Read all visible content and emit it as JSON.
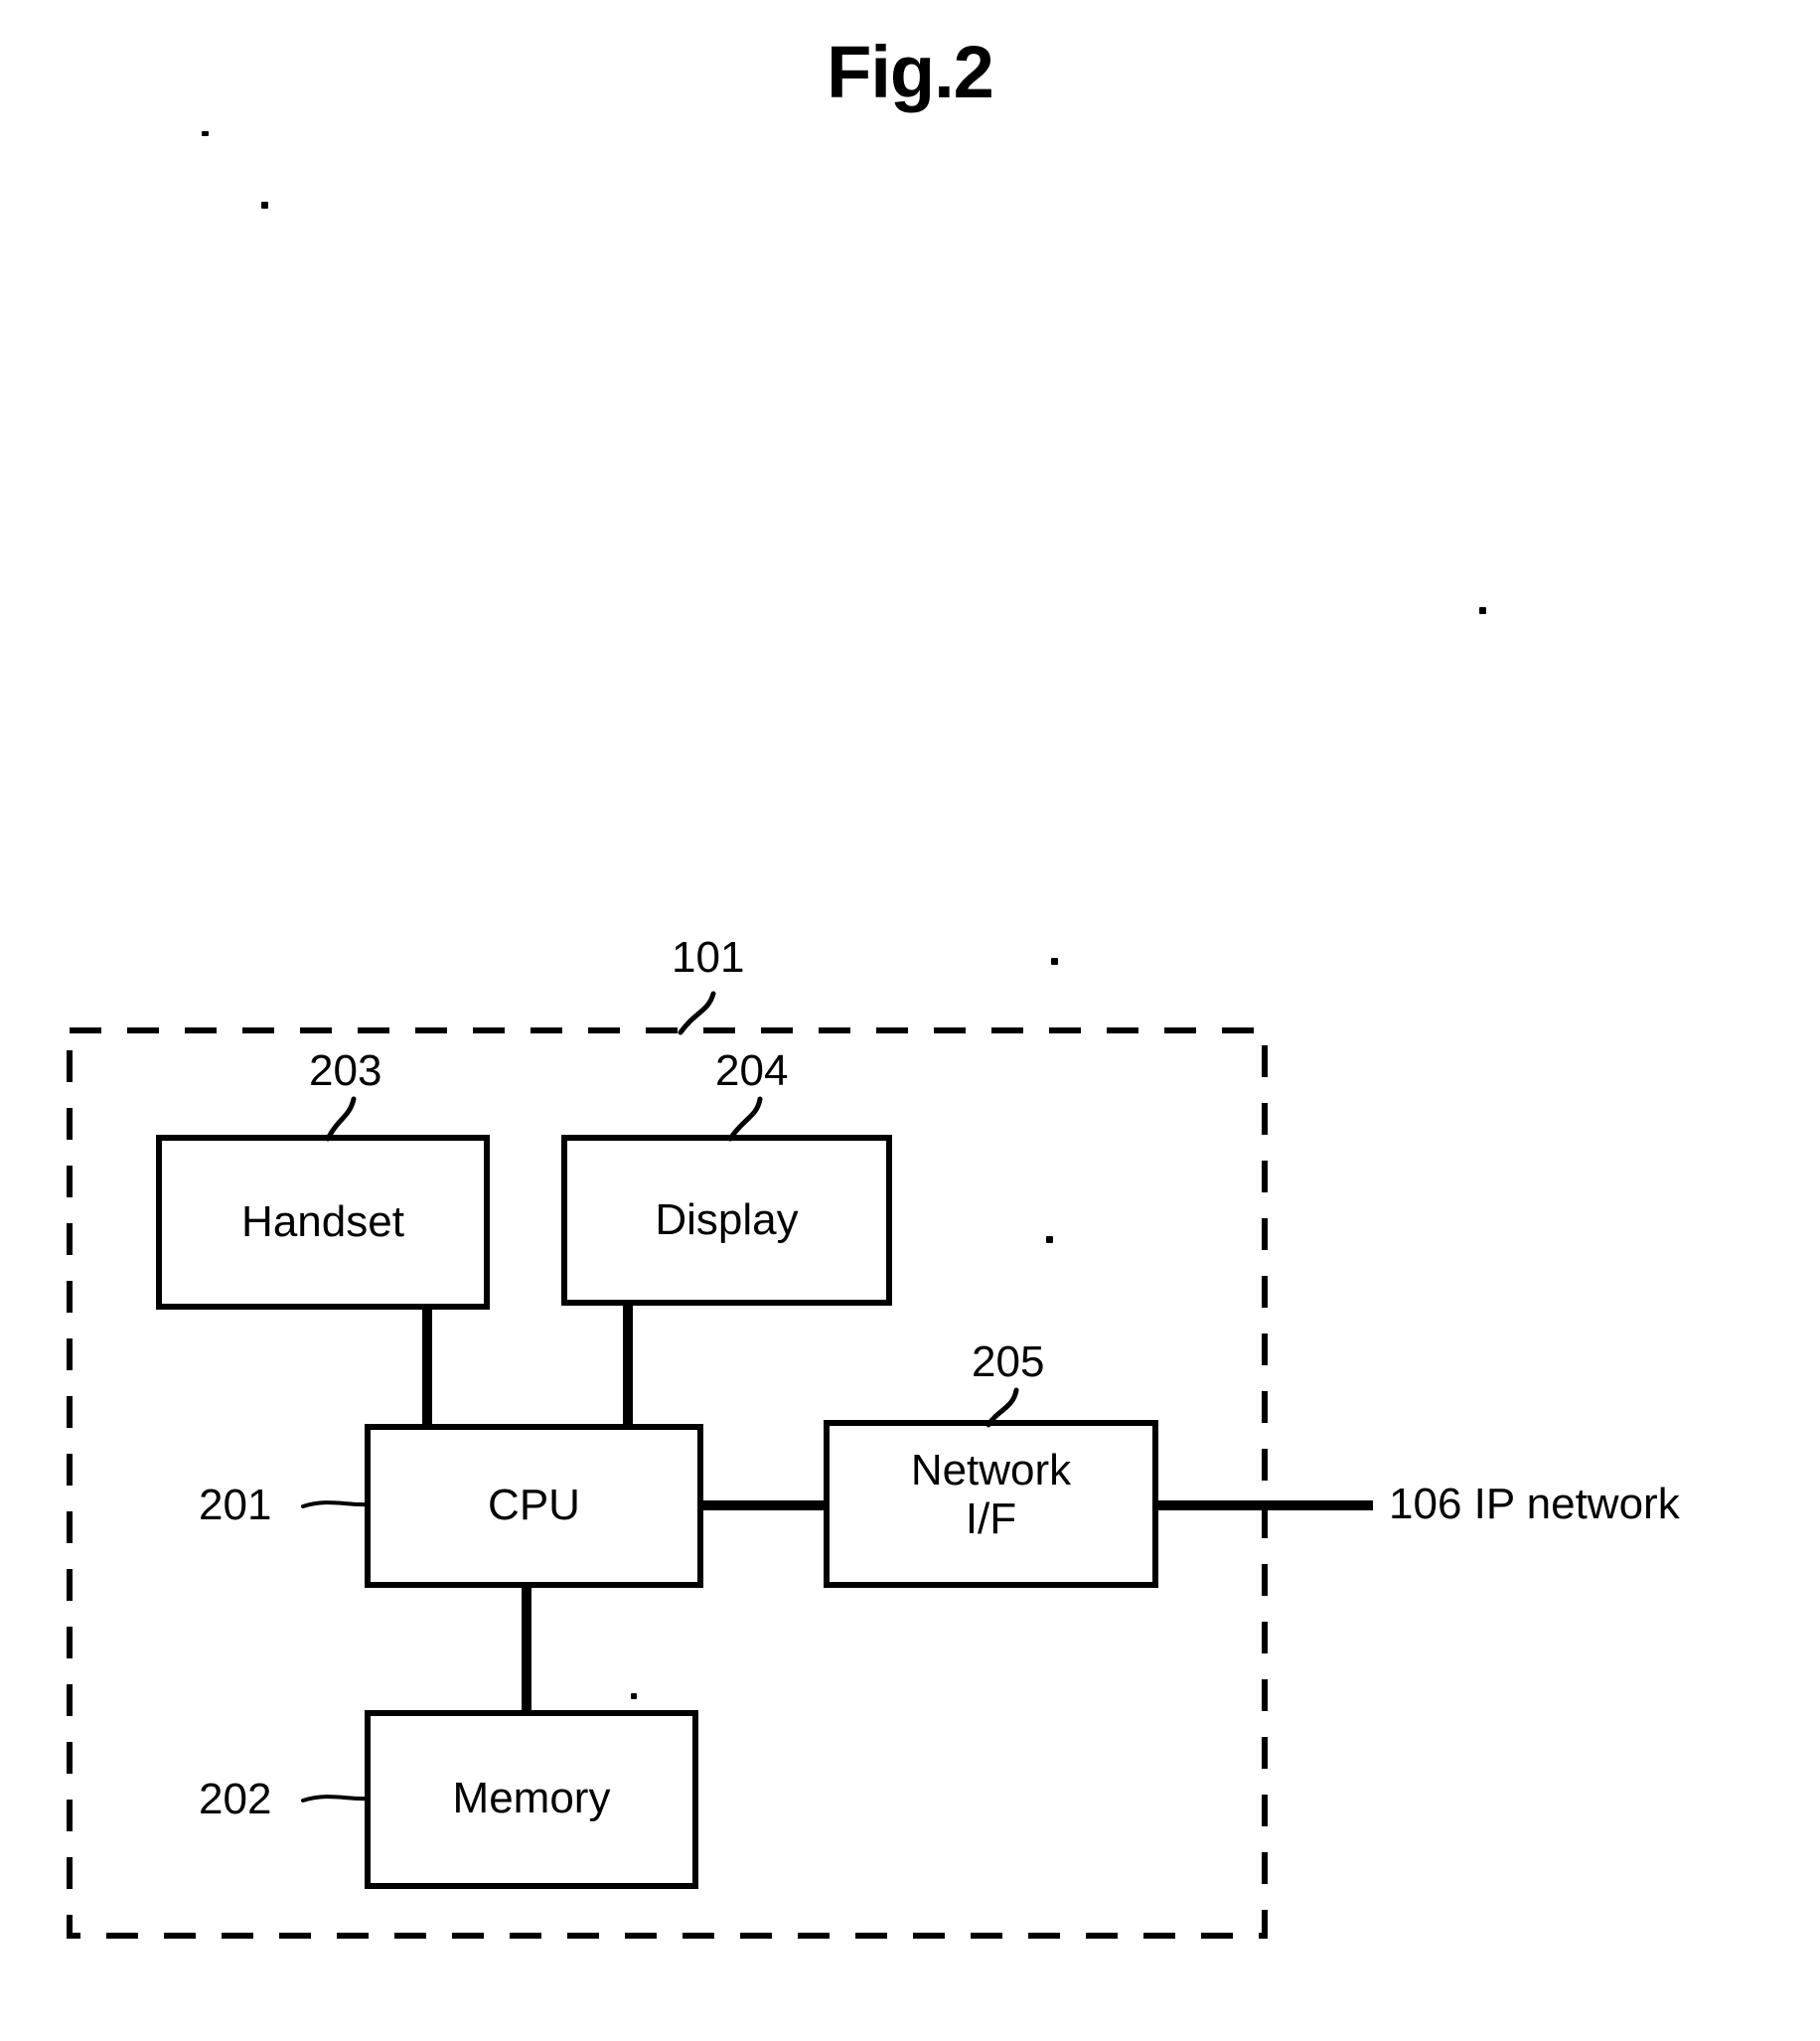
{
  "figure": {
    "title": "Fig.2",
    "enclosure_ref": "101",
    "external_link_label": "106 IP network"
  },
  "blocks": [
    {
      "id": "handset",
      "label": "Handset",
      "ref": "203"
    },
    {
      "id": "display",
      "label": "Display",
      "ref": "204"
    },
    {
      "id": "cpu",
      "label": "CPU",
      "ref": "201"
    },
    {
      "id": "network",
      "label": "Network\nI/F",
      "ref": "205"
    },
    {
      "id": "memory",
      "label": "Memory",
      "ref": "202"
    }
  ],
  "connections": [
    {
      "from": "handset",
      "to": "cpu"
    },
    {
      "from": "display",
      "to": "cpu"
    },
    {
      "from": "cpu",
      "to": "network"
    },
    {
      "from": "cpu",
      "to": "memory"
    },
    {
      "from": "network",
      "to": "106 IP network"
    }
  ],
  "style": {
    "ink": "#000000",
    "paper": "#ffffff"
  }
}
